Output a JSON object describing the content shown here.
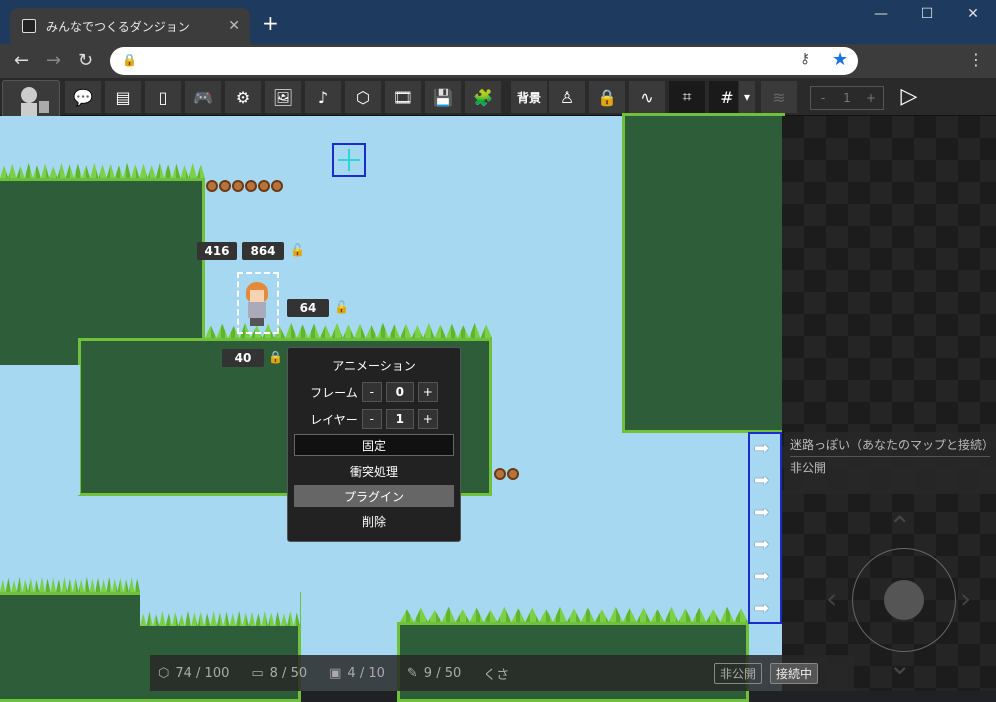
{
  "browser": {
    "tab_title": "みんなでつくるダンジョン",
    "close_tab": "✕",
    "new_tab": "+",
    "win_min": "—",
    "win_max": "☐",
    "win_close": "✕"
  },
  "toolbar": {
    "buttons": [
      {
        "name": "message-icon",
        "glyph": "💬"
      },
      {
        "name": "layers-icon",
        "glyph": "▤"
      },
      {
        "name": "door-icon",
        "glyph": "▯"
      },
      {
        "name": "gamepad-icon",
        "glyph": "🎮"
      },
      {
        "name": "gear-icon",
        "glyph": "⚙"
      },
      {
        "name": "image-icon",
        "glyph": "🖼"
      },
      {
        "name": "music-icon",
        "glyph": "♪"
      },
      {
        "name": "cube-icon",
        "glyph": "⬡"
      },
      {
        "name": "film-icon",
        "glyph": "🎞"
      },
      {
        "name": "save-icon",
        "glyph": "💾"
      },
      {
        "name": "plugin-icon",
        "glyph": "🧩"
      }
    ],
    "background_label": "背景",
    "buttons2": [
      {
        "name": "person-icon",
        "glyph": "♙"
      },
      {
        "name": "lock-icon",
        "glyph": "🔒"
      },
      {
        "name": "path-icon",
        "glyph": "∿"
      },
      {
        "name": "select-icon",
        "glyph": "⌗"
      },
      {
        "name": "grid-icon",
        "glyph": "#"
      }
    ],
    "dropdown": "▾",
    "stack_icon": "≋",
    "counter": {
      "minus": "-",
      "value": "1",
      "plus": "+"
    },
    "play": "▷"
  },
  "selection": {
    "x": "416",
    "y": "864",
    "width": "64",
    "height": "40"
  },
  "context_menu": {
    "animation": "アニメーション",
    "frame_label": "フレーム",
    "frame_value": "0",
    "layer_label": "レイヤー",
    "layer_value": "1",
    "minus": "-",
    "plus": "+",
    "fixed": "固定",
    "collision": "衝突処理",
    "plugin": "プラグイン",
    "delete": "削除"
  },
  "map_info": {
    "title": "迷路っぽい（あなたのマップと接続）",
    "visibility": "非公開"
  },
  "status_bar": {
    "objects": "74 / 100",
    "animations": "8 / 50",
    "images": "4 / 10",
    "plugins": "9 / 50",
    "author": "くさ",
    "private_label": "非公開",
    "connected_label": "接続中"
  }
}
